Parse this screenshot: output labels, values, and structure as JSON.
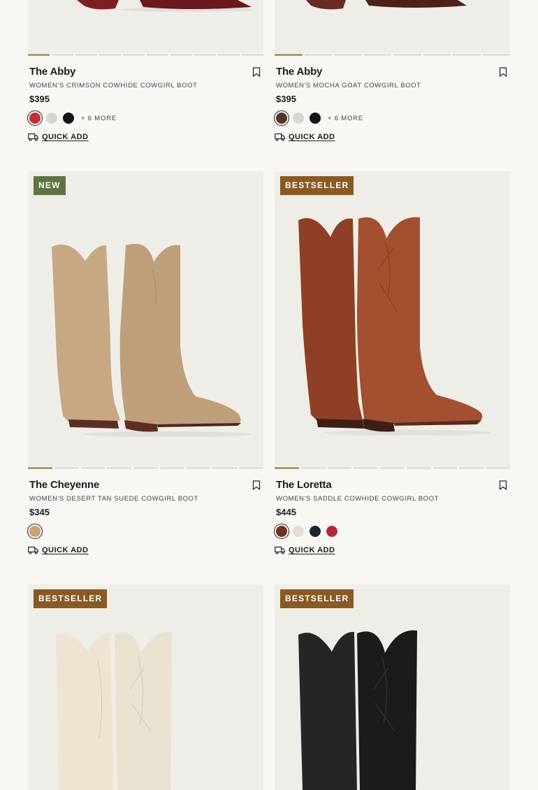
{
  "products": [
    {
      "name": "The Abby",
      "description": "WOMEN'S CRIMSON COWHIDE COWGIRL BOOT",
      "price": "$395",
      "badge": "",
      "swatches": [
        "#c2303a",
        "#d9d6d0",
        "#141414"
      ],
      "more_colors": "+ 6 MORE",
      "quick_add": "QUICK ADD",
      "boot_color": "#7d1f23",
      "carousel_active": 0
    },
    {
      "name": "The Abby",
      "description": "WOMEN'S MOCHA GOAT COWGIRL BOOT",
      "price": "$395",
      "badge": "",
      "swatches": [
        "#4f3629",
        "#d9d6d0",
        "#141414"
      ],
      "more_colors": "+ 6 MORE",
      "quick_add": "QUICK ADD",
      "boot_color": "#5b2720",
      "carousel_active": 0
    },
    {
      "name": "The Cheyenne",
      "description": "WOMEN'S DESERT TAN SUEDE COWGIRL BOOT",
      "price": "$345",
      "badge": "NEW",
      "badge_color": "#5f7442",
      "swatches": [
        "#c7a274"
      ],
      "more_colors": "",
      "quick_add": "QUICK ADD",
      "boot_color": "#bf9f79",
      "carousel_active": 0
    },
    {
      "name": "The Loretta",
      "description": "WOMEN'S SADDLE COWHIDE COWGIRL BOOT",
      "price": "$445",
      "badge": "BESTSELLER",
      "badge_color": "#8a5a22",
      "swatches": [
        "#6b3423",
        "#e5ddd0",
        "#1c2533",
        "#b5283a"
      ],
      "more_colors": "",
      "quick_add": "QUICK ADD",
      "boot_color": "#9c4a2c",
      "carousel_active": 0
    },
    {
      "name": "",
      "description": "",
      "price": "",
      "badge": "BESTSELLER",
      "badge_color": "#8a5a22",
      "swatches": [],
      "more_colors": "",
      "quick_add": "",
      "boot_color": "#e9e2d0"
    },
    {
      "name": "",
      "description": "",
      "price": "",
      "badge": "BESTSELLER",
      "badge_color": "#8a5a22",
      "swatches": [],
      "more_colors": "",
      "quick_add": "",
      "boot_color": "#1b1b1d"
    }
  ],
  "icons": {
    "wishlist": "bookmark-icon",
    "quick_add": "truck-icon"
  }
}
